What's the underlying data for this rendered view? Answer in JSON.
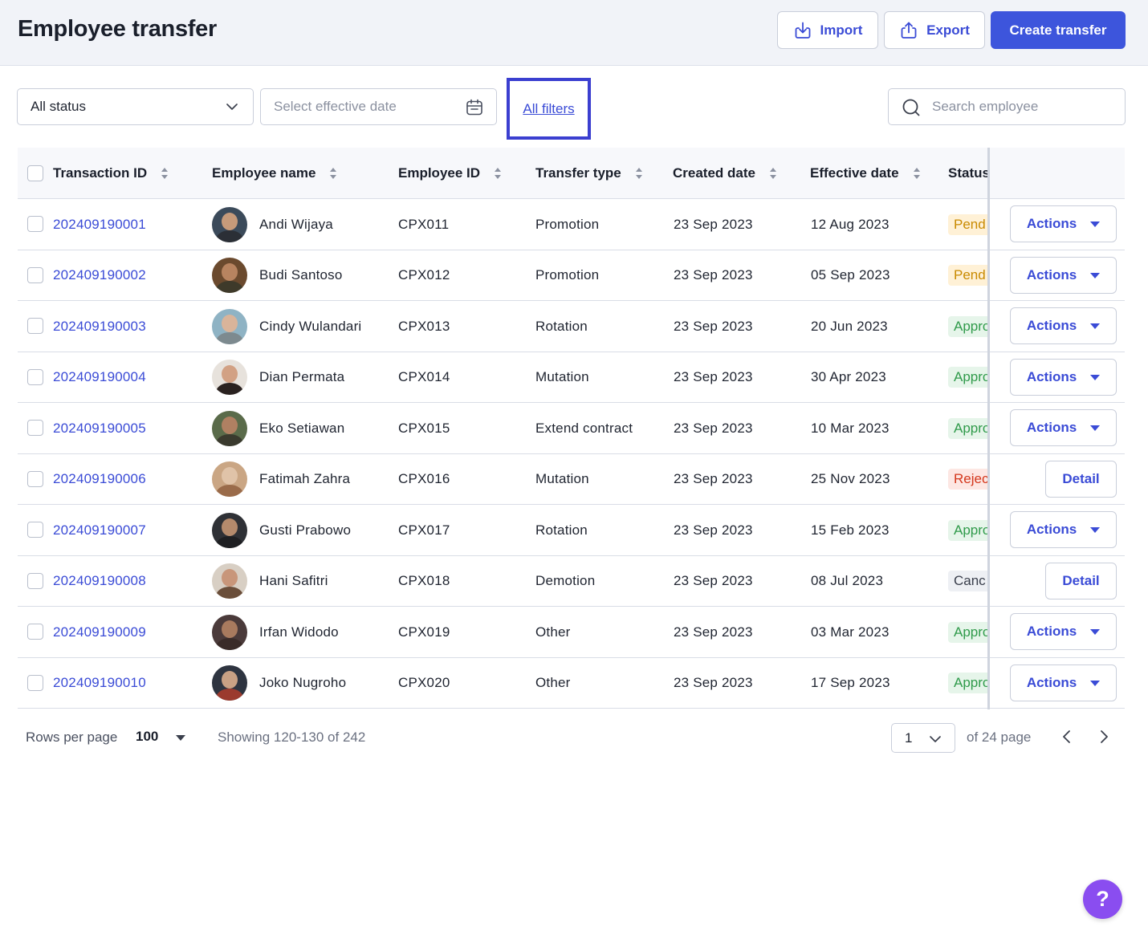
{
  "header": {
    "title": "Employee transfer",
    "import_label": "Import",
    "export_label": "Export",
    "create_label": "Create transfer"
  },
  "filters": {
    "status_value": "All status",
    "date_placeholder": "Select effective date",
    "all_filters_label": "All filters",
    "search_placeholder": "Search employee"
  },
  "table": {
    "columns": [
      "Transaction ID",
      "Employee name",
      "Employee ID",
      "Transfer type",
      "Created date",
      "Effective date",
      "Status"
    ],
    "rows": [
      {
        "txid": "202409190001",
        "name": "Andi Wijaya",
        "empid": "CPX011",
        "type": "Promotion",
        "created": "23 Sep 2023",
        "effective": "12 Aug 2023",
        "status": "Pend",
        "action": "Actions"
      },
      {
        "txid": "202409190002",
        "name": "Budi Santoso",
        "empid": "CPX012",
        "type": "Promotion",
        "created": "23 Sep 2023",
        "effective": "05 Sep 2023",
        "status": "Pend",
        "action": "Actions"
      },
      {
        "txid": "202409190003",
        "name": "Cindy Wulandari",
        "empid": "CPX013",
        "type": "Rotation",
        "created": "23 Sep 2023",
        "effective": "20 Jun 2023",
        "status": "Appro",
        "action": "Actions"
      },
      {
        "txid": "202409190004",
        "name": "Dian Permata",
        "empid": "CPX014",
        "type": "Mutation",
        "created": "23 Sep 2023",
        "effective": "30 Apr 2023",
        "status": "Appro",
        "action": "Actions"
      },
      {
        "txid": "202409190005",
        "name": "Eko Setiawan",
        "empid": "CPX015",
        "type": "Extend contract",
        "created": "23 Sep 2023",
        "effective": "10 Mar 2023",
        "status": "Appro",
        "action": "Actions"
      },
      {
        "txid": "202409190006",
        "name": "Fatimah Zahra",
        "empid": "CPX016",
        "type": "Mutation",
        "created": "23 Sep 2023",
        "effective": "25 Nov 2023",
        "status": "Rejec",
        "action": "Detail"
      },
      {
        "txid": "202409190007",
        "name": "Gusti Prabowo",
        "empid": "CPX017",
        "type": "Rotation",
        "created": "23 Sep 2023",
        "effective": "15 Feb 2023",
        "status": "Appro",
        "action": "Actions"
      },
      {
        "txid": "202409190008",
        "name": "Hani Safitri",
        "empid": "CPX018",
        "type": "Demotion",
        "created": "23 Sep 2023",
        "effective": "08 Jul 2023",
        "status": "Canc",
        "action": "Detail"
      },
      {
        "txid": "202409190009",
        "name": "Irfan Widodo",
        "empid": "CPX019",
        "type": "Other",
        "created": "23 Sep 2023",
        "effective": "03 Mar 2023",
        "status": "Appro",
        "action": "Actions"
      },
      {
        "txid": "202409190010",
        "name": "Joko Nugroho",
        "empid": "CPX020",
        "type": "Other",
        "created": "23 Sep 2023",
        "effective": "17 Sep 2023",
        "status": "Appro",
        "action": "Actions"
      }
    ]
  },
  "status_colors": {
    "Pend": {
      "fg": "#c98a00",
      "bg": "#fff1d6"
    },
    "Appro": {
      "fg": "#2f9a4a",
      "bg": "#e6f5ea"
    },
    "Rejec": {
      "fg": "#d4371c",
      "bg": "#fde7e3"
    },
    "Canc": {
      "fg": "#3a3f4c",
      "bg": "#eef0f4"
    }
  },
  "footer": {
    "rows_per_page_label": "Rows per page",
    "rows_per_page_value": "100",
    "showing_text": "Showing 120-130 of 242",
    "page_value": "1",
    "of_page_text": "of 24 page"
  },
  "help_label": "?",
  "colors": {
    "primary": "#3d55dc",
    "link": "#3a4bd6",
    "highlight_border": "#3b3fd0",
    "help_fab": "#8a4df0"
  }
}
